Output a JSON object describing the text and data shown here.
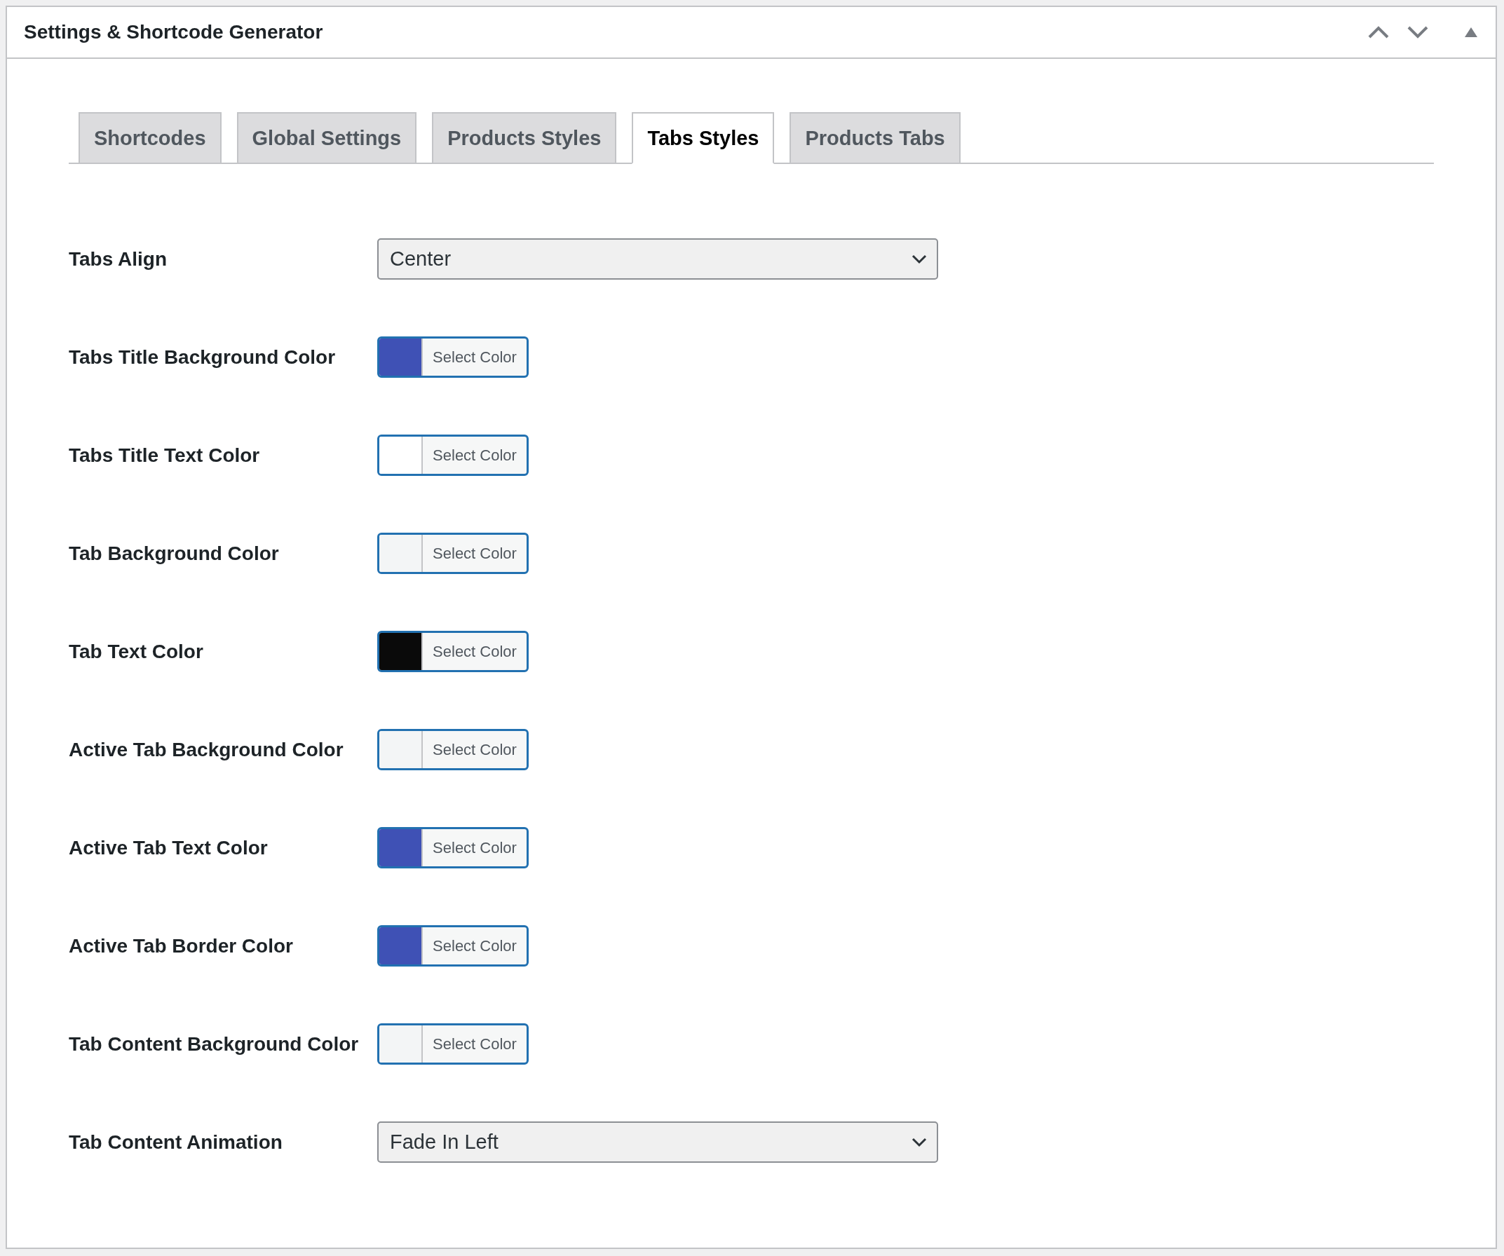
{
  "panel": {
    "title": "Settings & Shortcode Generator"
  },
  "tabs": [
    {
      "label": "Shortcodes",
      "selected": false
    },
    {
      "label": "Global Settings",
      "selected": false
    },
    {
      "label": "Products Styles",
      "selected": false
    },
    {
      "label": "Tabs Styles",
      "selected": true
    },
    {
      "label": "Products Tabs",
      "selected": false
    }
  ],
  "rows": [
    {
      "kind": "select",
      "label": "Tabs Align",
      "value": "Center"
    },
    {
      "kind": "color",
      "label": "Tabs Title Background Color",
      "button": "Select Color",
      "color": "#3f51b5"
    },
    {
      "kind": "color",
      "label": "Tabs Title Text Color",
      "button": "Select Color",
      "color": "#ffffff"
    },
    {
      "kind": "color",
      "label": "Tab Background Color",
      "button": "Select Color",
      "color": "#f3f5f6"
    },
    {
      "kind": "color",
      "label": "Tab Text Color",
      "button": "Select Color",
      "color": "#0a0a0a"
    },
    {
      "kind": "color",
      "label": "Active Tab Background Color",
      "button": "Select Color",
      "color": "#f3f5f6"
    },
    {
      "kind": "color",
      "label": "Active Tab Text Color",
      "button": "Select Color",
      "color": "#3f51b5"
    },
    {
      "kind": "color",
      "label": "Active Tab Border Color",
      "button": "Select Color",
      "color": "#3f51b5"
    },
    {
      "kind": "color",
      "label": "Tab Content Background Color",
      "button": "Select Color",
      "color": "#f3f5f6"
    },
    {
      "kind": "select",
      "label": "Tab Content Animation",
      "value": "Fade In Left"
    }
  ]
}
